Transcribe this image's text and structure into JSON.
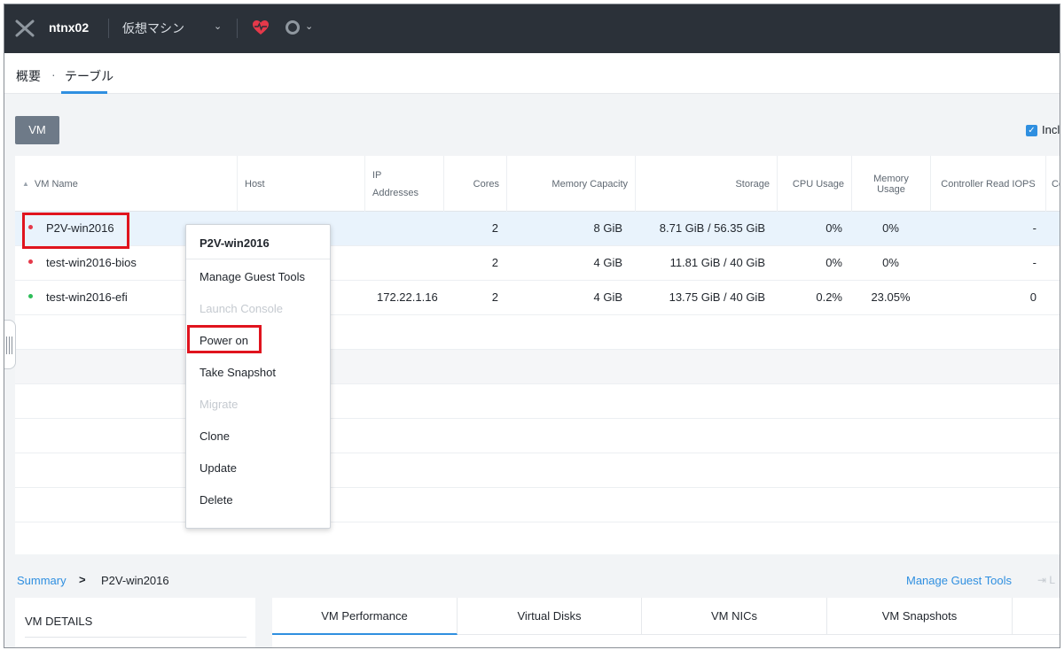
{
  "topbar": {
    "cluster_name": "ntnx02",
    "section": "仮想マシン",
    "colors": {
      "bar": "#2b3139",
      "health": "#e5394a"
    },
    "icons": [
      "nutanix-logo-icon",
      "chevron-down-icon",
      "heart-health-icon",
      "status-circle-icon"
    ]
  },
  "subnav": {
    "crumb_overview": "概要",
    "separator": "·",
    "crumb_table": "テーブル"
  },
  "toolbar": {
    "vm_button": "VM",
    "include_label": "Incl"
  },
  "table": {
    "columns": [
      "VM Name",
      "Host",
      "IP Addresses",
      "Cores",
      "Memory Capacity",
      "Storage",
      "CPU Usage",
      "Memory Usage",
      "Controller Read IOPS",
      "Co"
    ],
    "ip_header_line1": "IP",
    "ip_header_line2": "Addresses",
    "rows": [
      {
        "name": "P2V-win2016",
        "status": "off",
        "host": "",
        "ip": "",
        "cores": "2",
        "memory": "8 GiB",
        "storage": "8.71 GiB / 56.35 GiB",
        "cpu": "0%",
        "mem_usage": "0%",
        "read_iops": "-"
      },
      {
        "name": "test-win2016-bios",
        "status": "off",
        "host": "",
        "ip": "",
        "cores": "2",
        "memory": "4 GiB",
        "storage": "11.81 GiB / 40 GiB",
        "cpu": "0%",
        "mem_usage": "0%",
        "read_iops": "-"
      },
      {
        "name": "test-win2016-efi",
        "status": "on",
        "host": "",
        "ip": "172.22.1.16",
        "cores": "2",
        "memory": "4 GiB",
        "storage": "13.75 GiB / 40 GiB",
        "cpu": "0.2%",
        "mem_usage": "23.05%",
        "read_iops": "0"
      }
    ],
    "status_colors": {
      "off": "#e5394a",
      "on": "#2ebd59"
    }
  },
  "context_menu": {
    "header": "P2V-win2016",
    "items": [
      {
        "label": "Manage Guest Tools",
        "enabled": true
      },
      {
        "label": "Launch Console",
        "enabled": false
      },
      {
        "label": "Power on",
        "enabled": true
      },
      {
        "label": "Take Snapshot",
        "enabled": true
      },
      {
        "label": "Migrate",
        "enabled": false
      },
      {
        "label": "Clone",
        "enabled": true
      },
      {
        "label": "Update",
        "enabled": true
      },
      {
        "label": "Delete",
        "enabled": true
      }
    ]
  },
  "summary": {
    "link": "Summary",
    "arrow": ">",
    "vm_name": "P2V-win2016",
    "manage_guest_tools": "Manage Guest Tools",
    "extra": "⇥ L",
    "details_title": "VM DETAILS"
  },
  "tabs": [
    "VM Performance",
    "Virtual Disks",
    "VM NICs",
    "VM Snapshots"
  ]
}
